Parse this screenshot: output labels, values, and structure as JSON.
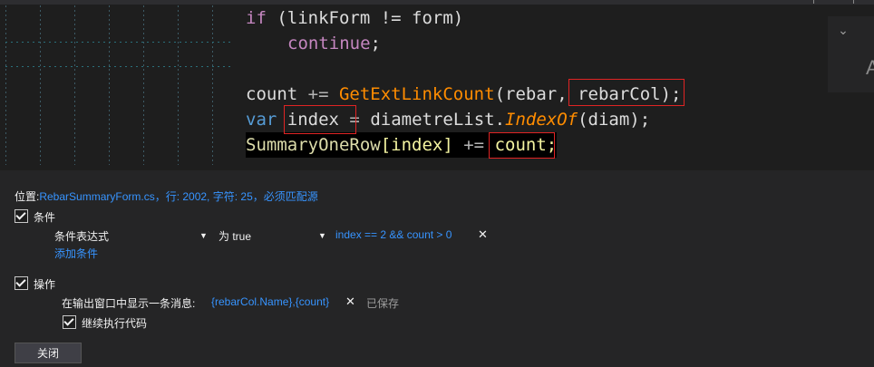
{
  "code": {
    "line1": {
      "if": "if",
      "rest": " (linkForm != form)"
    },
    "line2": {
      "continue": "continue",
      "semi": ";"
    },
    "line4": {
      "count": "count",
      "op": " += ",
      "fn": "GetExtLinkCount",
      "args": "(rebar, ",
      "param": "rebarCol",
      "end": ");"
    },
    "line5": {
      "var": "var",
      "sp": " ",
      "index": "index",
      "eq": " = ",
      "list": "diametreList.",
      "method": "IndexOf",
      "args": "(diam);"
    },
    "line6": {
      "summary": "SummaryOneRow",
      "idx": "[index]",
      "op": " += ",
      "count": "count;"
    }
  },
  "right_panel": {
    "chevron": "⌄",
    "letter": "A"
  },
  "panel": {
    "location_label": "位置:",
    "location_value": "RebarSummaryForm.cs，行: 2002, 字符: 25，必须匹配源",
    "conditions_label": "条件",
    "condition_type": "条件表达式",
    "condition_when": "为 true",
    "condition_expr": "index == 2 && count > 0",
    "add_condition": "添加条件",
    "actions_label": "操作",
    "message_label": "在输出窗口中显示一条消息:",
    "message_value": "{rebarCol.Name},{count}",
    "saved_label": "已保存",
    "continue_label": "继续执行代码",
    "close_button": "关闭"
  },
  "colors": {
    "accent_link": "#3794ff",
    "highlight_box": "#e02424",
    "panel_bg": "#252526",
    "editor_bg": "#1e1e1e"
  }
}
